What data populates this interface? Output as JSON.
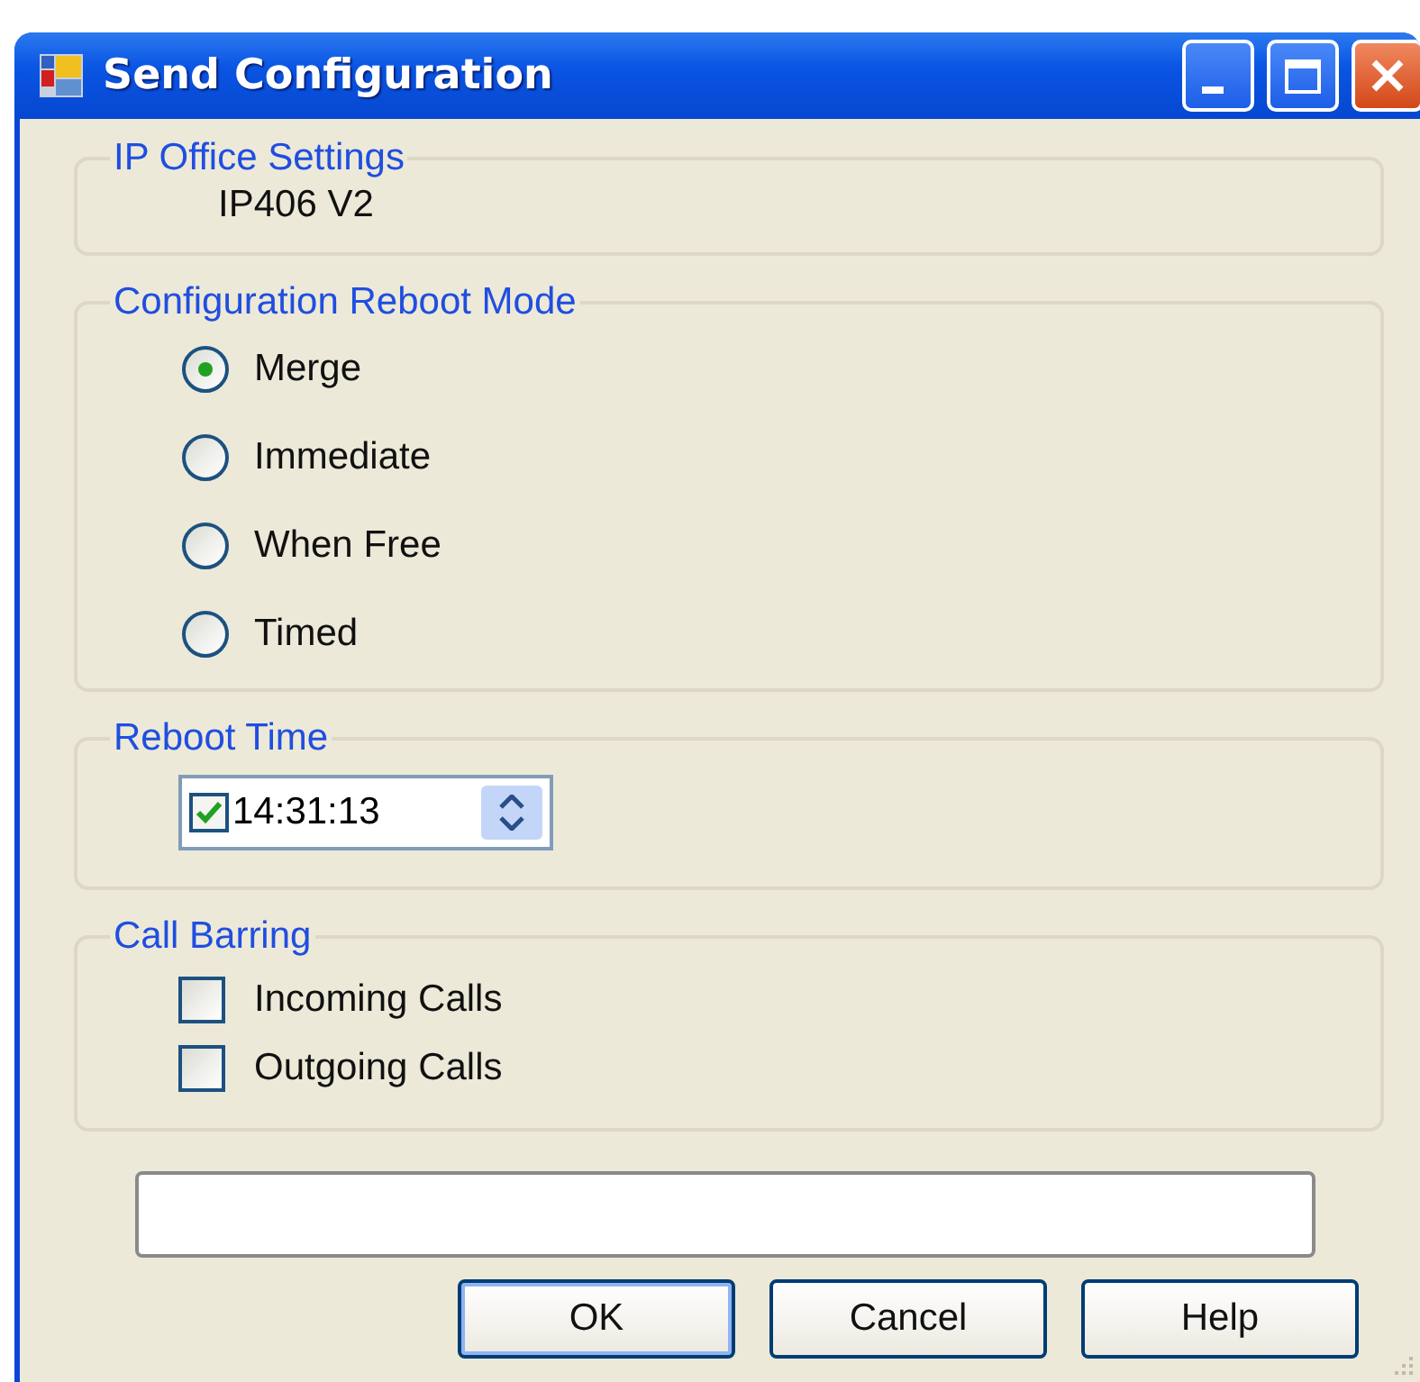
{
  "window": {
    "title": "Send Configuration"
  },
  "ip_office_settings": {
    "label": "IP Office Settings",
    "value": "IP406 V2"
  },
  "reboot_mode": {
    "label": "Configuration Reboot Mode",
    "options": [
      {
        "label": "Merge",
        "selected": true
      },
      {
        "label": "Immediate",
        "selected": false
      },
      {
        "label": "When Free",
        "selected": false
      },
      {
        "label": "Timed",
        "selected": false
      }
    ]
  },
  "reboot_time": {
    "label": "Reboot Time",
    "checked": true,
    "value": "14:31:13"
  },
  "call_barring": {
    "label": "Call Barring",
    "options": [
      {
        "label": "Incoming Calls",
        "checked": false
      },
      {
        "label": "Outgoing Calls",
        "checked": false
      }
    ]
  },
  "buttons": [
    {
      "label": "OK",
      "default": true
    },
    {
      "label": "Cancel",
      "default": false
    },
    {
      "label": "Help",
      "default": false
    }
  ]
}
